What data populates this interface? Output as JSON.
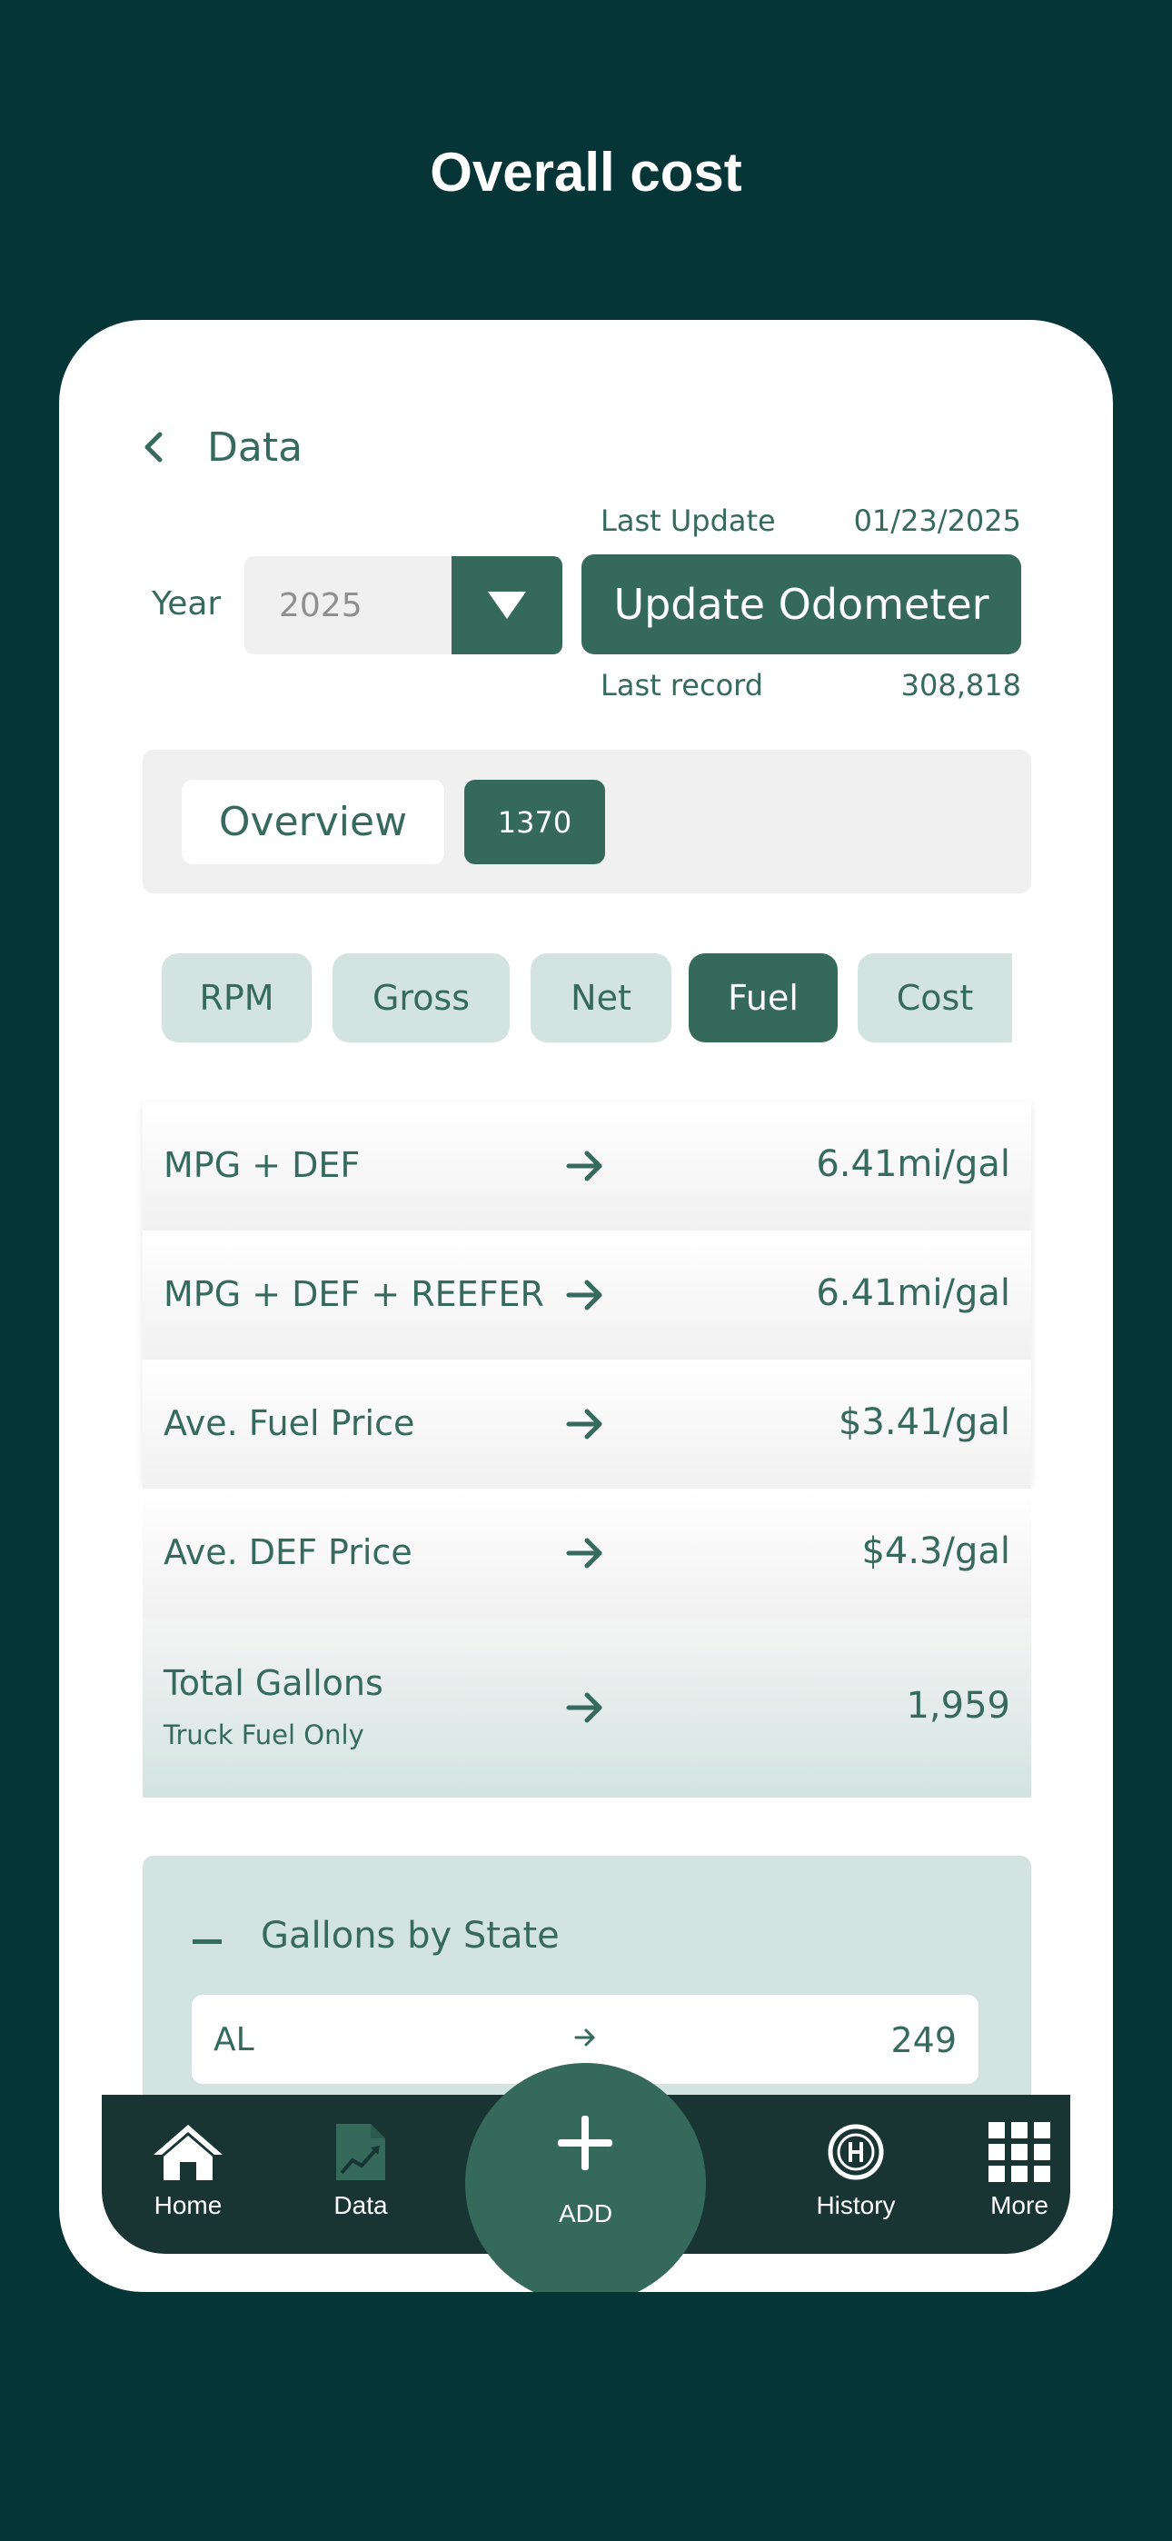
{
  "page_title": "Overall cost",
  "topnav": {
    "back_label": "Data"
  },
  "odometer": {
    "last_update_label": "Last Update",
    "last_update_value": "01/23/2025",
    "year_label": "Year",
    "year_value": "2025",
    "update_button": "Update Odometer",
    "last_record_label": "Last record",
    "last_record_value": "308,818"
  },
  "overview": {
    "tab_label": "Overview",
    "count": "1370"
  },
  "chips": [
    {
      "label": "RPM",
      "active": false
    },
    {
      "label": "Gross",
      "active": false
    },
    {
      "label": "Net",
      "active": false
    },
    {
      "label": "Fuel",
      "active": true
    },
    {
      "label": "Cost",
      "active": false
    }
  ],
  "metrics": [
    {
      "label": "MPG + DEF",
      "value": "6.41mi/gal"
    },
    {
      "label": "MPG + DEF + REEFER",
      "value": "6.41mi/gal"
    },
    {
      "label": "Ave. Fuel Price",
      "value": "$3.41/gal"
    },
    {
      "label": "Ave. DEF Price",
      "value": "$4.3/gal"
    },
    {
      "label": "Total Gallons",
      "sublabel": "Truck Fuel Only",
      "value": "1,959"
    }
  ],
  "gallons_by_state": {
    "title": "Gallons by State",
    "rows": [
      {
        "state": "AL",
        "value": "249"
      }
    ]
  },
  "bottom_nav": {
    "home": "Home",
    "data": "Data",
    "add": "ADD",
    "history": "History",
    "more": "More"
  },
  "colors": {
    "background": "#063538",
    "accent": "#35695a",
    "chip_inactive": "#d3e4e0",
    "nav_bar": "#183534"
  }
}
